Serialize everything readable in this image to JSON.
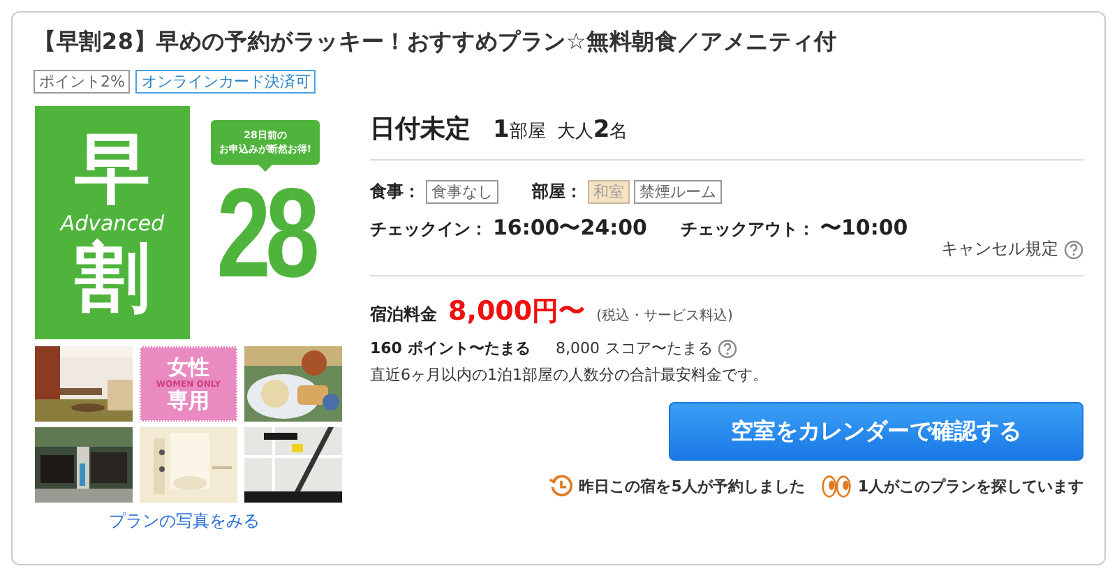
{
  "title": "【早割28】早めの予約がラッキー！おすすめプラン☆無料朝食／アメニティ付",
  "tags": [
    {
      "label": "ポイント2%",
      "kind": "plain"
    },
    {
      "label": "オンラインカード決済可",
      "kind": "accent"
    }
  ],
  "banner": {
    "left_top": "早",
    "english": "Advanced",
    "left_bottom": "割",
    "bubble": [
      "28日前の",
      "お申込みが断然お得!"
    ],
    "number": "28"
  },
  "photos": [
    {
      "kind": "picture"
    },
    {
      "kind": "label",
      "lines": [
        "女性",
        "専用"
      ],
      "subtext": "WOMEN ONLY"
    },
    {
      "kind": "picture"
    },
    {
      "kind": "picture"
    },
    {
      "kind": "picture"
    },
    {
      "kind": "picture"
    }
  ],
  "photos_link": "プランの写真をみる",
  "stay": {
    "date": "日付未定",
    "rooms": "1",
    "rooms_unit": "部屋",
    "adults_label": "大人",
    "adults": "2",
    "adults_unit": "名"
  },
  "meal": {
    "label": "食事：",
    "tags": [
      {
        "label": "食事なし",
        "kind": "plain"
      }
    ]
  },
  "room": {
    "label": "部屋：",
    "tags": [
      {
        "label": "和室",
        "kind": "highlight"
      },
      {
        "label": "禁煙ルーム",
        "kind": "plain"
      }
    ]
  },
  "checkin": {
    "label": "チェックイン：",
    "value": "16:00〜24:00"
  },
  "checkout": {
    "label": "チェックアウト：",
    "value": "〜10:00"
  },
  "cancel_policy": "キャンセル規定",
  "price": {
    "label": "宿泊料金",
    "value": "8,000円〜",
    "note": "(税込・サービス料込)"
  },
  "points": {
    "value": "160",
    "text": "ポイント〜たまる",
    "score": "8,000",
    "score_text": "スコア〜たまる"
  },
  "price_note": "直近6ヶ月以内の1泊1部屋の人数分の合計最安料金です。",
  "button": "空室をカレンダーで確認する",
  "stats": [
    {
      "kind": "clock",
      "text": "昨日この宿を5人が予約しました"
    },
    {
      "kind": "eyes",
      "text": "1人がこのプランを探しています"
    }
  ]
}
